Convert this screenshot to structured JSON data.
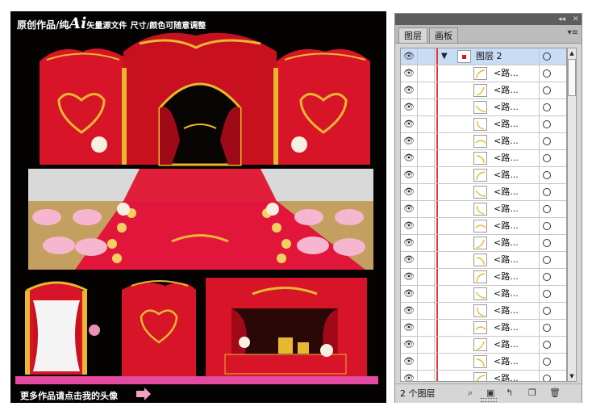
{
  "artwork": {
    "caption_top_a": "原创作品/纯",
    "caption_top_ai": "Ai",
    "caption_top_b": "矢量源文件",
    "caption_top_c": "尺寸/颜色可随意调整",
    "caption_bottom": "更多作品请点击我的头像",
    "colors": {
      "red": "#d81428",
      "gold": "#e8b830",
      "dark": "#050202",
      "pink": "#f2a0c4"
    }
  },
  "panel": {
    "title_icons": [
      "collapse-arrows-icon",
      "close-icon"
    ],
    "tabs": [
      {
        "label": "图层",
        "active": true
      },
      {
        "label": "画板",
        "active": false
      }
    ],
    "top_layer": {
      "name": "图层 2",
      "expanded": true
    },
    "items": [
      {
        "name": "<路..."
      },
      {
        "name": "<路..."
      },
      {
        "name": "<路..."
      },
      {
        "name": "<路..."
      },
      {
        "name": "<路..."
      },
      {
        "name": "<路..."
      },
      {
        "name": "<路..."
      },
      {
        "name": "<路..."
      },
      {
        "name": "<路..."
      },
      {
        "name": "<路..."
      },
      {
        "name": "<路..."
      },
      {
        "name": "<路..."
      },
      {
        "name": "<路..."
      },
      {
        "name": "<路..."
      },
      {
        "name": "<路..."
      },
      {
        "name": "<路..."
      },
      {
        "name": "<路..."
      },
      {
        "name": "<路..."
      },
      {
        "name": "<路..."
      }
    ],
    "footer": {
      "layer_count": "2 个图层",
      "icons": [
        "locate-object-icon",
        "make-clipping-mask-icon",
        "new-sublayer-icon",
        "new-layer-icon",
        "delete-layer-icon"
      ]
    }
  }
}
